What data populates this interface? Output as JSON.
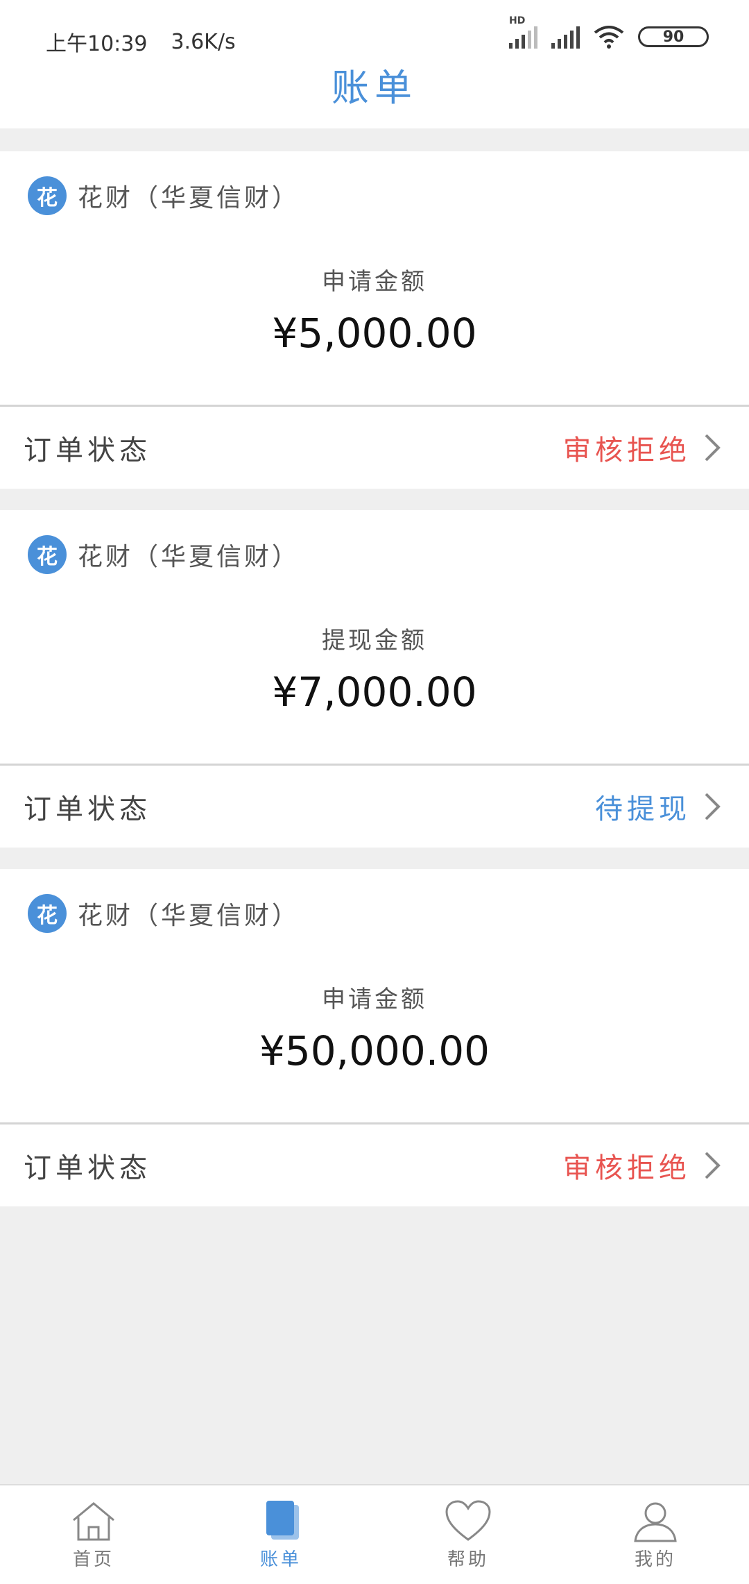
{
  "status_bar": {
    "time": "上午10:39",
    "speed": "3.6K/s",
    "network_type": "HD",
    "battery": "90"
  },
  "header": {
    "title": "账单"
  },
  "colors": {
    "accent": "#4a90d9",
    "rejected": "#e85450",
    "pending": "#4a90d9"
  },
  "orders": [
    {
      "brand_icon_text": "花",
      "brand_name": "花财（华夏信财）",
      "amount_label": "申请金额",
      "amount": "¥5,000.00",
      "status_label": "订单状态",
      "status_value": "审核拒绝"
    },
    {
      "brand_icon_text": "花",
      "brand_name": "花财（华夏信财）",
      "amount_label": "提现金额",
      "amount": "¥7,000.00",
      "status_label": "订单状态",
      "status_value": "待提现"
    },
    {
      "brand_icon_text": "花",
      "brand_name": "花财（华夏信财）",
      "amount_label": "申请金额",
      "amount": "¥50,000.00",
      "status_label": "订单状态",
      "status_value": "审核拒绝"
    }
  ],
  "tabbar": {
    "items": [
      {
        "label": "首页",
        "icon": "home-icon",
        "active": false
      },
      {
        "label": "账单",
        "icon": "bill-icon",
        "active": true
      },
      {
        "label": "帮助",
        "icon": "heart-icon",
        "active": false
      },
      {
        "label": "我的",
        "icon": "user-icon",
        "active": false
      }
    ]
  }
}
